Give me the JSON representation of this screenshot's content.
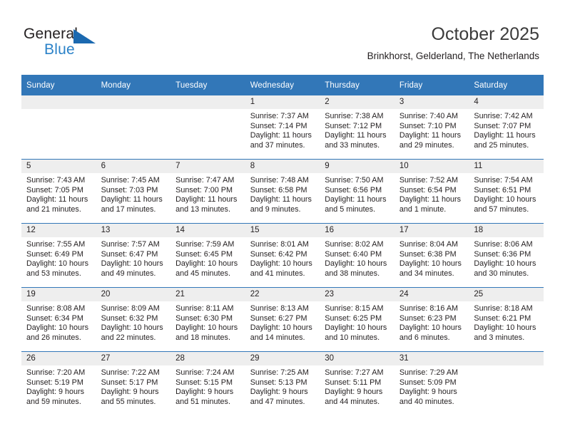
{
  "brand": {
    "name_part1": "General",
    "name_part2": "Blue",
    "color_dark": "#231f20",
    "color_blue": "#2b82c8",
    "triangle_color": "#1b69b0"
  },
  "header": {
    "title": "October 2025",
    "subtitle": "Brinkhorst, Gelderland, The Netherlands"
  },
  "theme": {
    "header_row_bg": "#3277b8",
    "header_row_text": "#ffffff",
    "daynum_bg": "#eeeeee",
    "grid_line": "#3277b8"
  },
  "weekdays": [
    "Sunday",
    "Monday",
    "Tuesday",
    "Wednesday",
    "Thursday",
    "Friday",
    "Saturday"
  ],
  "weeks": [
    [
      {
        "day": "",
        "blank": true,
        "sunrise": "",
        "sunset": "",
        "daylight1": "",
        "daylight2": ""
      },
      {
        "day": "",
        "blank": true,
        "sunrise": "",
        "sunset": "",
        "daylight1": "",
        "daylight2": ""
      },
      {
        "day": "",
        "blank": true,
        "sunrise": "",
        "sunset": "",
        "daylight1": "",
        "daylight2": ""
      },
      {
        "day": "1",
        "sunrise": "Sunrise: 7:37 AM",
        "sunset": "Sunset: 7:14 PM",
        "daylight1": "Daylight: 11 hours",
        "daylight2": "and 37 minutes."
      },
      {
        "day": "2",
        "sunrise": "Sunrise: 7:38 AM",
        "sunset": "Sunset: 7:12 PM",
        "daylight1": "Daylight: 11 hours",
        "daylight2": "and 33 minutes."
      },
      {
        "day": "3",
        "sunrise": "Sunrise: 7:40 AM",
        "sunset": "Sunset: 7:10 PM",
        "daylight1": "Daylight: 11 hours",
        "daylight2": "and 29 minutes."
      },
      {
        "day": "4",
        "sunrise": "Sunrise: 7:42 AM",
        "sunset": "Sunset: 7:07 PM",
        "daylight1": "Daylight: 11 hours",
        "daylight2": "and 25 minutes."
      }
    ],
    [
      {
        "day": "5",
        "sunrise": "Sunrise: 7:43 AM",
        "sunset": "Sunset: 7:05 PM",
        "daylight1": "Daylight: 11 hours",
        "daylight2": "and 21 minutes."
      },
      {
        "day": "6",
        "sunrise": "Sunrise: 7:45 AM",
        "sunset": "Sunset: 7:03 PM",
        "daylight1": "Daylight: 11 hours",
        "daylight2": "and 17 minutes."
      },
      {
        "day": "7",
        "sunrise": "Sunrise: 7:47 AM",
        "sunset": "Sunset: 7:00 PM",
        "daylight1": "Daylight: 11 hours",
        "daylight2": "and 13 minutes."
      },
      {
        "day": "8",
        "sunrise": "Sunrise: 7:48 AM",
        "sunset": "Sunset: 6:58 PM",
        "daylight1": "Daylight: 11 hours",
        "daylight2": "and 9 minutes."
      },
      {
        "day": "9",
        "sunrise": "Sunrise: 7:50 AM",
        "sunset": "Sunset: 6:56 PM",
        "daylight1": "Daylight: 11 hours",
        "daylight2": "and 5 minutes."
      },
      {
        "day": "10",
        "sunrise": "Sunrise: 7:52 AM",
        "sunset": "Sunset: 6:54 PM",
        "daylight1": "Daylight: 11 hours",
        "daylight2": "and 1 minute."
      },
      {
        "day": "11",
        "sunrise": "Sunrise: 7:54 AM",
        "sunset": "Sunset: 6:51 PM",
        "daylight1": "Daylight: 10 hours",
        "daylight2": "and 57 minutes."
      }
    ],
    [
      {
        "day": "12",
        "sunrise": "Sunrise: 7:55 AM",
        "sunset": "Sunset: 6:49 PM",
        "daylight1": "Daylight: 10 hours",
        "daylight2": "and 53 minutes."
      },
      {
        "day": "13",
        "sunrise": "Sunrise: 7:57 AM",
        "sunset": "Sunset: 6:47 PM",
        "daylight1": "Daylight: 10 hours",
        "daylight2": "and 49 minutes."
      },
      {
        "day": "14",
        "sunrise": "Sunrise: 7:59 AM",
        "sunset": "Sunset: 6:45 PM",
        "daylight1": "Daylight: 10 hours",
        "daylight2": "and 45 minutes."
      },
      {
        "day": "15",
        "sunrise": "Sunrise: 8:01 AM",
        "sunset": "Sunset: 6:42 PM",
        "daylight1": "Daylight: 10 hours",
        "daylight2": "and 41 minutes."
      },
      {
        "day": "16",
        "sunrise": "Sunrise: 8:02 AM",
        "sunset": "Sunset: 6:40 PM",
        "daylight1": "Daylight: 10 hours",
        "daylight2": "and 38 minutes."
      },
      {
        "day": "17",
        "sunrise": "Sunrise: 8:04 AM",
        "sunset": "Sunset: 6:38 PM",
        "daylight1": "Daylight: 10 hours",
        "daylight2": "and 34 minutes."
      },
      {
        "day": "18",
        "sunrise": "Sunrise: 8:06 AM",
        "sunset": "Sunset: 6:36 PM",
        "daylight1": "Daylight: 10 hours",
        "daylight2": "and 30 minutes."
      }
    ],
    [
      {
        "day": "19",
        "sunrise": "Sunrise: 8:08 AM",
        "sunset": "Sunset: 6:34 PM",
        "daylight1": "Daylight: 10 hours",
        "daylight2": "and 26 minutes."
      },
      {
        "day": "20",
        "sunrise": "Sunrise: 8:09 AM",
        "sunset": "Sunset: 6:32 PM",
        "daylight1": "Daylight: 10 hours",
        "daylight2": "and 22 minutes."
      },
      {
        "day": "21",
        "sunrise": "Sunrise: 8:11 AM",
        "sunset": "Sunset: 6:30 PM",
        "daylight1": "Daylight: 10 hours",
        "daylight2": "and 18 minutes."
      },
      {
        "day": "22",
        "sunrise": "Sunrise: 8:13 AM",
        "sunset": "Sunset: 6:27 PM",
        "daylight1": "Daylight: 10 hours",
        "daylight2": "and 14 minutes."
      },
      {
        "day": "23",
        "sunrise": "Sunrise: 8:15 AM",
        "sunset": "Sunset: 6:25 PM",
        "daylight1": "Daylight: 10 hours",
        "daylight2": "and 10 minutes."
      },
      {
        "day": "24",
        "sunrise": "Sunrise: 8:16 AM",
        "sunset": "Sunset: 6:23 PM",
        "daylight1": "Daylight: 10 hours",
        "daylight2": "and 6 minutes."
      },
      {
        "day": "25",
        "sunrise": "Sunrise: 8:18 AM",
        "sunset": "Sunset: 6:21 PM",
        "daylight1": "Daylight: 10 hours",
        "daylight2": "and 3 minutes."
      }
    ],
    [
      {
        "day": "26",
        "sunrise": "Sunrise: 7:20 AM",
        "sunset": "Sunset: 5:19 PM",
        "daylight1": "Daylight: 9 hours",
        "daylight2": "and 59 minutes."
      },
      {
        "day": "27",
        "sunrise": "Sunrise: 7:22 AM",
        "sunset": "Sunset: 5:17 PM",
        "daylight1": "Daylight: 9 hours",
        "daylight2": "and 55 minutes."
      },
      {
        "day": "28",
        "sunrise": "Sunrise: 7:24 AM",
        "sunset": "Sunset: 5:15 PM",
        "daylight1": "Daylight: 9 hours",
        "daylight2": "and 51 minutes."
      },
      {
        "day": "29",
        "sunrise": "Sunrise: 7:25 AM",
        "sunset": "Sunset: 5:13 PM",
        "daylight1": "Daylight: 9 hours",
        "daylight2": "and 47 minutes."
      },
      {
        "day": "30",
        "sunrise": "Sunrise: 7:27 AM",
        "sunset": "Sunset: 5:11 PM",
        "daylight1": "Daylight: 9 hours",
        "daylight2": "and 44 minutes."
      },
      {
        "day": "31",
        "sunrise": "Sunrise: 7:29 AM",
        "sunset": "Sunset: 5:09 PM",
        "daylight1": "Daylight: 9 hours",
        "daylight2": "and 40 minutes."
      },
      {
        "day": "",
        "blank": true,
        "sunrise": "",
        "sunset": "",
        "daylight1": "",
        "daylight2": ""
      }
    ]
  ]
}
